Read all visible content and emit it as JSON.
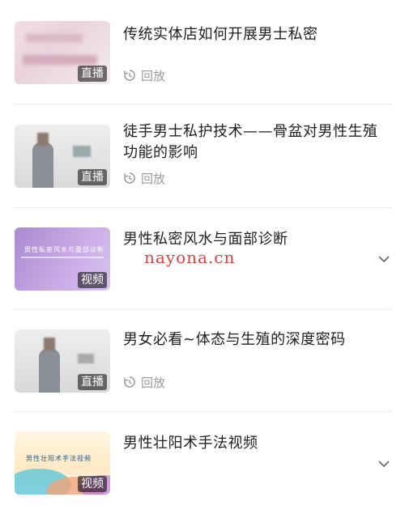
{
  "items": [
    {
      "title": "传统实体店如何开展男士私密",
      "badge": "直播",
      "replay": "回放"
    },
    {
      "title": "徒手男士私护技术——骨盆对男性生殖功能的影响",
      "badge": "直播",
      "replay": "回放"
    },
    {
      "title": "男性私密风水与面部诊断",
      "badge": "视频",
      "thumb_text": "男性私密风水与面部诊断"
    },
    {
      "title": "男女必看~体态与生殖的深度密码",
      "badge": "直播",
      "replay": "回放"
    },
    {
      "title": "男性壮阳术手法视频",
      "badge": "视频",
      "thumb_text": "男性壮阳术手法视频"
    }
  ],
  "watermark": "nayona.cn",
  "icons": {
    "replay": "replay-icon",
    "expand": "chevron-down-icon"
  },
  "colors": {
    "divider": "#ececec",
    "secondary_text": "#9a9a9a",
    "watermark": "#e04040"
  }
}
